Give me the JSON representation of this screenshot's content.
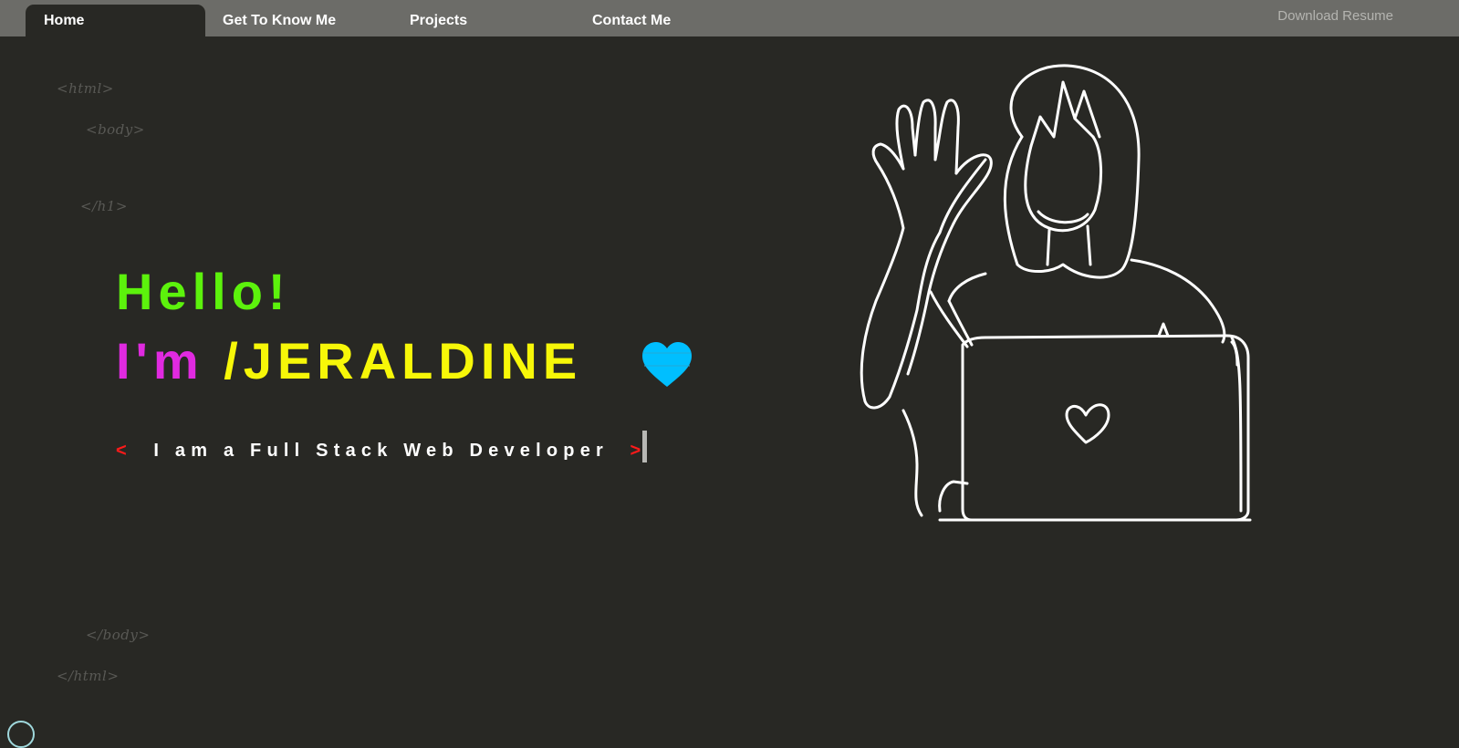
{
  "nav": {
    "tabs": [
      {
        "label": "Home",
        "active": true
      },
      {
        "label": "Get To Know Me",
        "active": false
      },
      {
        "label": "Projects",
        "active": false
      },
      {
        "label": "Contact Me",
        "active": false
      }
    ],
    "download_label": "Download Resume"
  },
  "code_decor": {
    "html_open": "<html>",
    "body_open": "<body>",
    "h1_close": "</h1>",
    "body_close": "</body>",
    "html_close": "</html>"
  },
  "hero": {
    "greeting": "Hello!",
    "intro": "I'm",
    "name": "/JERALDINE",
    "bracket_open": "<",
    "tagline": "I am a Full Stack Web Developer",
    "bracket_close": ">"
  },
  "colors": {
    "background": "#282824",
    "navbar": "#6c6c68",
    "greeting": "#5cf20c",
    "intro": "#e02ae0",
    "name": "#f7f708",
    "heart": "#00bfff",
    "bracket": "#ff1a1a",
    "line_art": "#ffffff"
  },
  "icons": {
    "heart": "heart-icon",
    "illustration": "waving-person-with-laptop-illustration"
  }
}
